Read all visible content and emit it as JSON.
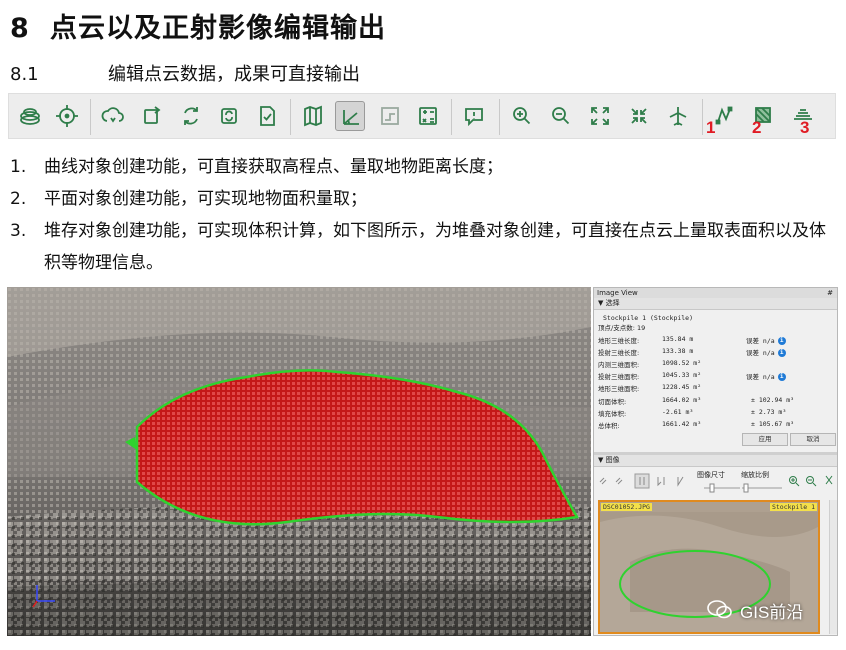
{
  "heading": {
    "number": "8",
    "title": "点云以及正射影像编辑输出"
  },
  "subheading": {
    "number": "8.1",
    "title": "编辑点云数据，成果可直接输出"
  },
  "toolbar": {
    "icons": [
      "layers-icon",
      "crosshair-icon",
      "cloud-refresh-icon",
      "rotate-box-icon",
      "sync-icon",
      "sync-box-icon",
      "check-document-icon",
      "map-icon",
      "measure-angle-icon",
      "step-icon",
      "calculator-icon",
      "comment-icon",
      "zoom-in-icon",
      "zoom-out-icon",
      "expand-icon",
      "collapse-icon",
      "airplane-icon",
      "polyline-icon",
      "polygon-icon",
      "stockpile-icon"
    ],
    "markers": [
      "1",
      "2",
      "3"
    ],
    "marker_color": "#e01b24"
  },
  "list": [
    {
      "num": "1.",
      "text": "曲线对象创建功能，可直接获取高程点、量取地物距离长度；"
    },
    {
      "num": "2.",
      "text": "平面对象创建功能，可实现地物面积量取；"
    },
    {
      "num": "3.",
      "text": "堆存对象创建功能，可实现体积计算，如下图所示，为堆叠对象创建，可直接在点云上量取表面积以及体积等物理信息。"
    }
  ],
  "panel": {
    "window_title": "Image View",
    "pin": "#",
    "selection_header": "▼ 选择",
    "stockpile_name": "Stockpile 1 (Stockpile)",
    "vertices_label": "顶点/支点数:",
    "vertices_value": "19",
    "rows": [
      {
        "label": "地形三维长度:",
        "value": "135.84 m",
        "err_label": "误差",
        "err_value": "n/a"
      },
      {
        "label": "投射三维长度:",
        "value": "133.38 m",
        "err_label": "误差",
        "err_value": "n/a"
      },
      {
        "label": "内测三维面积:",
        "value": "1098.52 m²",
        "err_label": "",
        "err_value": ""
      },
      {
        "label": "投射三维面积:",
        "value": "1045.33 m²",
        "err_label": "误差",
        "err_value": "n/a"
      },
      {
        "label": "地形三维面积:",
        "value": "1228.45 m²",
        "err_label": "",
        "err_value": ""
      },
      {
        "label": "切面体积:",
        "value": "1664.02 m³",
        "err_label": "±",
        "err_value": "102.94 m³"
      },
      {
        "label": "填充体积:",
        "value": "-2.61 m³",
        "err_label": "±",
        "err_value": "2.73 m³"
      },
      {
        "label": "总体积:",
        "value": "1661.42 m³",
        "err_label": "±",
        "err_value": "105.67 m³"
      }
    ],
    "apply_button": "应用",
    "cancel_button": "取消",
    "image_header": "▼ 图像",
    "image_size_label": "图像尺寸",
    "zoom_ratio_label": "缩放比例",
    "thumb_file": "DSC01052.JPG",
    "thumb_object": "Stockpile 1"
  },
  "watermark": "GIS前沿",
  "colors": {
    "mesh_red": "#d21f1f",
    "outline_green": "#2fd22f",
    "panel_bg": "#f0f0f0"
  }
}
